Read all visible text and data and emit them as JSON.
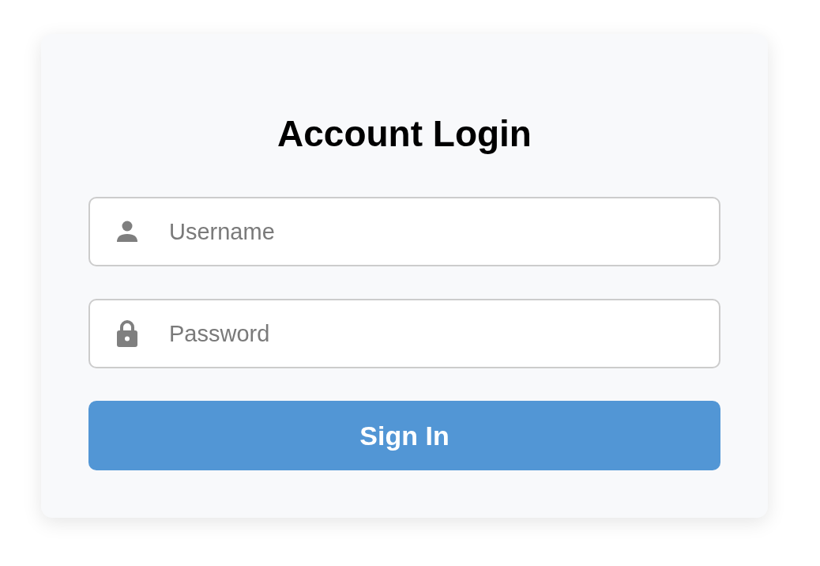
{
  "title": "Account Login",
  "fields": [
    {
      "kind": "user",
      "placeholder": "Username"
    },
    {
      "kind": "lock",
      "placeholder": "Password"
    }
  ],
  "button": "Sign In"
}
